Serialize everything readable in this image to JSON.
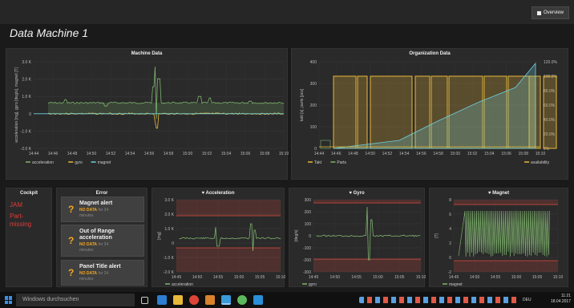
{
  "header": {
    "overview_label": "Overview",
    "dashboard_title": "Data Machine 1"
  },
  "colors": {
    "accel": "#7eb26d",
    "gyro": "#eab839",
    "magnet": "#6ed0e0",
    "takt": "#eab839",
    "parts": "#7eb26d",
    "availability": "#6ed0e0",
    "alert": "#e24d42"
  },
  "machine": {
    "title": "Machine Data",
    "ylabel": "acceleration [mg], gyro [deg/s], magnet [T]",
    "yticks": [
      "3.0 K",
      "2.0 K",
      "1.0 K",
      "0",
      "-1.0 K",
      "-2.0 K"
    ],
    "xticks": [
      "14:44",
      "14:46",
      "14:48",
      "14:50",
      "14:52",
      "14:54",
      "14:56",
      "14:58",
      "15:00",
      "15:02",
      "15:04",
      "15:06",
      "15:08",
      "15:10"
    ],
    "legend": [
      "acceleration",
      "gyro",
      "magnet"
    ]
  },
  "org": {
    "title": "Organization Data",
    "ylabel": "takt [s], parts [pcs]",
    "yticks_left": [
      "400",
      "300",
      "200",
      "100",
      "0"
    ],
    "yticks_right": [
      "120.0%",
      "100.0%",
      "80.0%",
      "60.0%",
      "40.0%",
      "20.0%",
      "0%"
    ],
    "xticks": [
      "14:44",
      "14:46",
      "14:48",
      "14:50",
      "14:52",
      "14:54",
      "14:56",
      "14:58",
      "15:00",
      "15:02",
      "15:04",
      "15:06",
      "15:08",
      "15:10"
    ],
    "legend": [
      "Takt",
      "Parts",
      "availability"
    ]
  },
  "cockpit": {
    "title": "Cockpit",
    "items": [
      "JAM",
      "Part-",
      "missing"
    ]
  },
  "error": {
    "title": "Error",
    "alerts": [
      {
        "title": "Magnet alert",
        "status": "NO DATA",
        "for_label": "for 24",
        "unit": "minutes"
      },
      {
        "title": "Out of Range acceleration",
        "status": "NO DATA",
        "for_label": "for 24",
        "unit": "minutes"
      },
      {
        "title": "Panel Title alert",
        "status": "NO DATA",
        "for_label": "for 24",
        "unit": "minutes"
      }
    ]
  },
  "acceleration": {
    "title": "Acceleration",
    "ylabel": "[mg]",
    "yticks": [
      "3.0 K",
      "2.0 K",
      "1.0 K",
      "0",
      "-1.0 K",
      "-2.0 K"
    ],
    "xticks": [
      "14:45",
      "14:50",
      "14:55",
      "15:00",
      "15:05",
      "15:10"
    ],
    "legend": [
      "acceleration"
    ]
  },
  "gyro": {
    "title": "Gyro",
    "ylabel": "[deg/s]",
    "yticks": [
      "300",
      "200",
      "100",
      "0",
      "-100",
      "-200",
      "-300"
    ],
    "xticks": [
      "14:45",
      "14:50",
      "14:55",
      "15:00",
      "15:05",
      "15:10"
    ],
    "legend": [
      "gyro"
    ]
  },
  "magnet": {
    "title": "Magnet",
    "ylabel": "[T]",
    "yticks": [
      "8",
      "6",
      "4",
      "2",
      "0",
      "-2"
    ],
    "xticks": [
      "14:45",
      "14:50",
      "14:55",
      "15:00",
      "15:05",
      "15:10"
    ],
    "legend": [
      "magnet"
    ]
  },
  "taskbar": {
    "search_placeholder": "Windows durchsuchen",
    "time": "11:21",
    "date": "18.04.2017",
    "lang": "DEU"
  }
}
